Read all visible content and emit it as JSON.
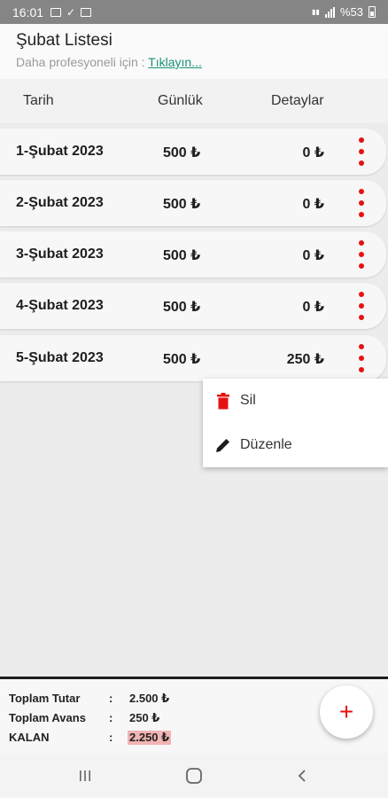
{
  "status_bar": {
    "time": "16:01",
    "battery_text": "%53",
    "left_icons": [
      "gallery-icon",
      "check-icon",
      "translate-icon"
    ],
    "right_icons": [
      "volte-icon",
      "signal-icon",
      "battery-icon"
    ]
  },
  "header": {
    "title": "Şubat Listesi",
    "subtitle": "Daha profesyoneli için : ",
    "link_text": "Tıklayın..."
  },
  "columns": {
    "date": "Tarih",
    "daily": "Günlük",
    "details": "Detaylar"
  },
  "rows": [
    {
      "date": "1-Şubat 2023",
      "daily": "500 ₺",
      "detail": "0 ₺"
    },
    {
      "date": "2-Şubat 2023",
      "daily": "500 ₺",
      "detail": "0 ₺"
    },
    {
      "date": "3-Şubat 2023",
      "daily": "500 ₺",
      "detail": "0 ₺"
    },
    {
      "date": "4-Şubat 2023",
      "daily": "500 ₺",
      "detail": "0 ₺"
    },
    {
      "date": "5-Şubat 2023",
      "daily": "500 ₺",
      "detail": "250 ₺"
    }
  ],
  "menu": {
    "delete_label": "Sil",
    "edit_label": "Düzenle"
  },
  "totals": {
    "total_label": "Toplam Tutar",
    "total_value": "2.500 ₺",
    "advance_label": "Toplam Avans",
    "advance_value": "250 ₺",
    "remaining_label": "KALAN",
    "remaining_value": "2.250 ₺",
    "separator": ":"
  },
  "fab": {
    "label": "+"
  },
  "colors": {
    "accent_red": "#e51212",
    "link_green": "#1b9278",
    "highlight_red": "#f2b3b3"
  }
}
